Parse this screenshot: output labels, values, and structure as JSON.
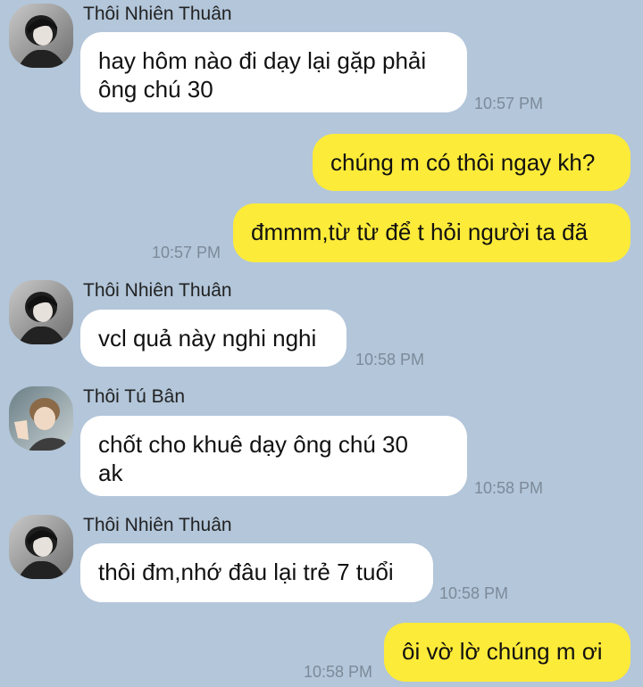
{
  "messages": [
    {
      "sender": "Thôi Nhiên Thuân",
      "text": "hay hôm nào đi dạy lại gặp phải\nông chú 30",
      "time": "10:57 PM"
    },
    {
      "sender": "me",
      "text": "chúng m có thôi ngay kh?",
      "time": ""
    },
    {
      "sender": "me",
      "text": "đmmm,từ từ để t hỏi người ta đã",
      "time": "10:57 PM"
    },
    {
      "sender": "Thôi Nhiên Thuân",
      "text": "vcl quả này nghi nghi",
      "time": "10:58 PM"
    },
    {
      "sender": "Thôi Tú Bân",
      "text": "chốt cho khuê dạy ông chú 30\nak",
      "time": "10:58 PM"
    },
    {
      "sender": "Thôi Nhiên Thuân",
      "text": "thôi đm,nhớ đâu lại trẻ 7 tuổi",
      "time": "10:58 PM"
    },
    {
      "sender": "me",
      "text": "ôi vờ lờ chúng m ơi",
      "time": "10:58 PM"
    }
  ],
  "colors": {
    "background": "#b3c6da",
    "incoming_bubble": "#ffffff",
    "outgoing_bubble": "#fdeb39",
    "timestamp": "#7c8a99"
  },
  "avatars": [
    "avatar-dark-hair-person",
    "avatar-light-hair-waving-person"
  ]
}
